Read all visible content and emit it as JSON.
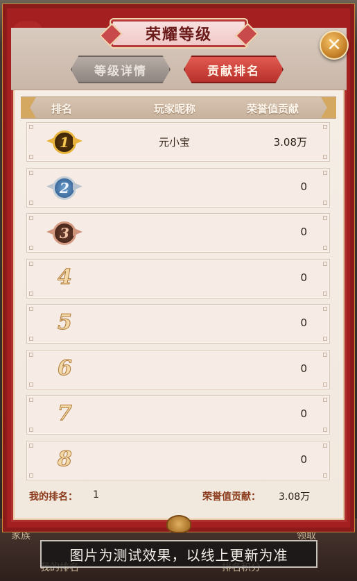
{
  "title": "荣耀等级",
  "tabs": [
    {
      "label": "等级详情",
      "active": false
    },
    {
      "label": "贡献排名",
      "active": true
    }
  ],
  "columns": {
    "rank": "排名",
    "nickname": "玩家昵称",
    "contribution": "荣誉值贡献"
  },
  "rows": [
    {
      "rank": "1",
      "medal": "gold",
      "nickname": "元小宝",
      "contribution": "3.08万"
    },
    {
      "rank": "2",
      "medal": "silver",
      "nickname": "",
      "contribution": "0"
    },
    {
      "rank": "3",
      "medal": "bronze",
      "nickname": "",
      "contribution": "0"
    },
    {
      "rank": "4",
      "medal": "",
      "nickname": "",
      "contribution": "0"
    },
    {
      "rank": "5",
      "medal": "",
      "nickname": "",
      "contribution": "0"
    },
    {
      "rank": "6",
      "medal": "",
      "nickname": "",
      "contribution": "0"
    },
    {
      "rank": "7",
      "medal": "",
      "nickname": "",
      "contribution": "0"
    },
    {
      "rank": "8",
      "medal": "",
      "nickname": "",
      "contribution": "0"
    }
  ],
  "footer": {
    "my_rank_label": "我的排名：",
    "my_rank_value": "1",
    "my_contrib_label": "荣誉值贡献：",
    "my_contrib_value": "3.08万"
  },
  "background": {
    "left_text": "家族",
    "right_text": "领取",
    "bottom_left_text": "我的排名",
    "bottom_right_text": "排名积分"
  },
  "notice": "图片为测试效果，以线上更新为准",
  "colors": {
    "frame_red": "#8b1a1a",
    "tab_active": "#c83a32",
    "tab_inactive": "#9c938e",
    "header_text": "#fff8ef",
    "gold": "#e8b43c"
  }
}
